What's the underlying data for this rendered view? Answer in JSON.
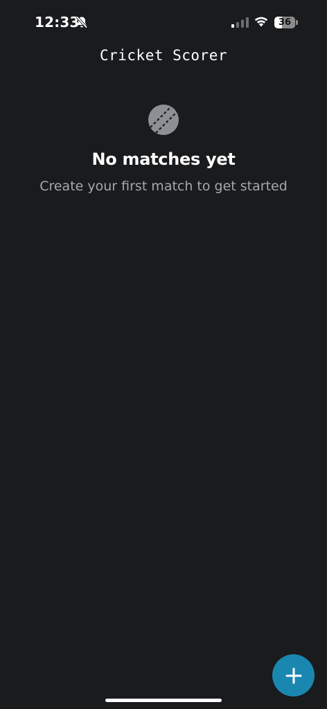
{
  "status_bar": {
    "time": "12:33",
    "battery_level": "36",
    "battery_fraction": 0.36,
    "icons": [
      "bell-slash-icon",
      "cellular-signal-icon",
      "wifi-icon",
      "battery-icon"
    ]
  },
  "header": {
    "title": "Cricket Scorer"
  },
  "empty_state": {
    "icon": "cricket-ball-icon",
    "title": "No matches yet",
    "subtitle": "Create your first match to get started"
  },
  "fab": {
    "icon": "plus-icon",
    "color": "#1a87b0"
  },
  "colors": {
    "background": "#191b1d",
    "text_primary": "#ffffff",
    "text_secondary": "#a6a8ab",
    "accent": "#1a87b0",
    "icon_gray": "#8c8f93"
  }
}
